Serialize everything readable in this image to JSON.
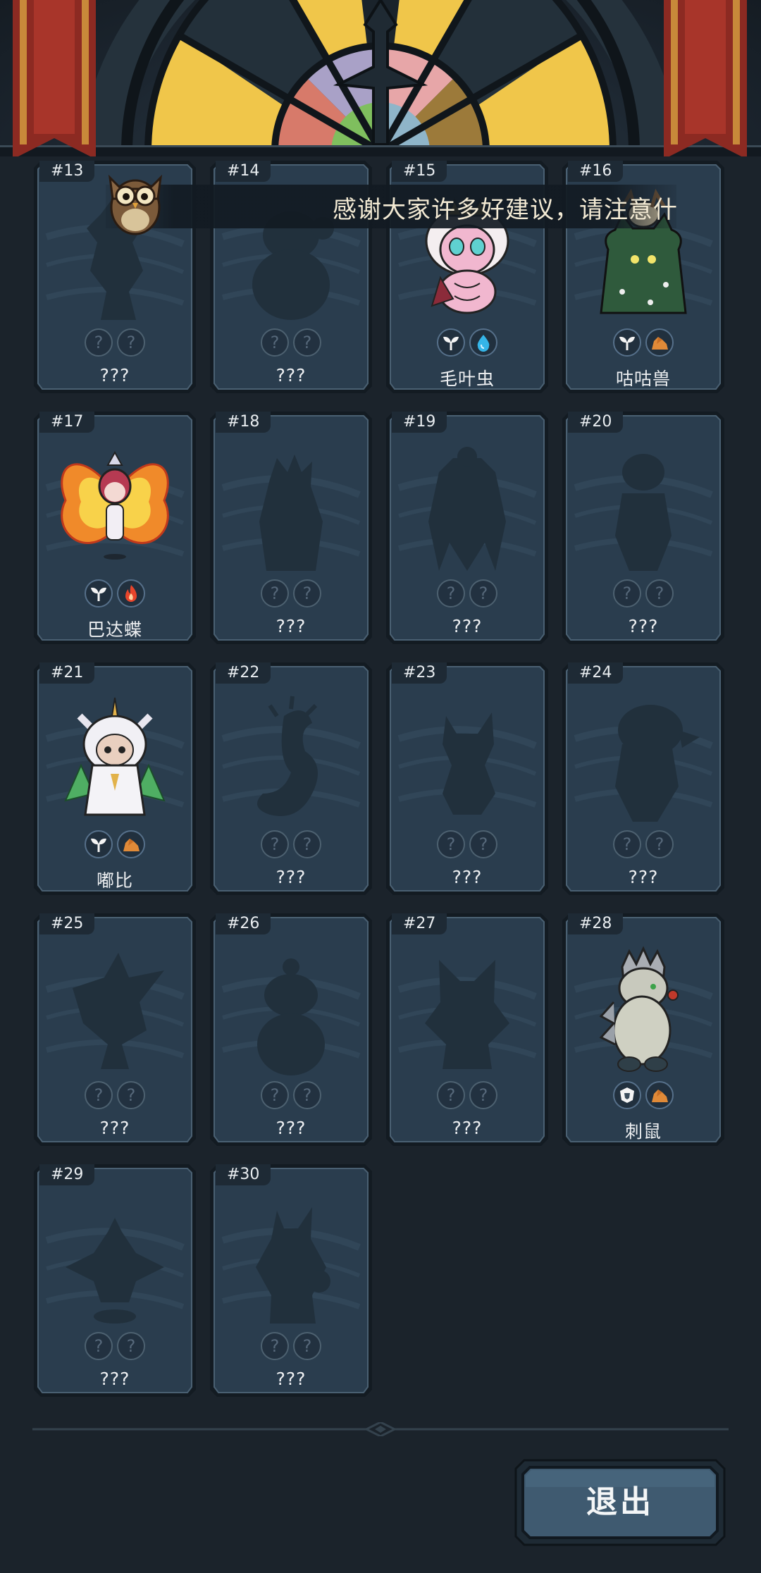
{
  "ticker": {
    "text": "感谢大家许多好建议，请注意什"
  },
  "cards": [
    {
      "id": "#13",
      "name": "???",
      "discovered": false,
      "elements": [
        "?",
        "?"
      ]
    },
    {
      "id": "#14",
      "name": "???",
      "discovered": false,
      "elements": [
        "?",
        "?"
      ]
    },
    {
      "id": "#15",
      "name": "毛叶虫",
      "discovered": true,
      "elements": [
        "leaf-icon",
        "water-icon"
      ]
    },
    {
      "id": "#16",
      "name": "咕咕兽",
      "discovered": true,
      "elements": [
        "leaf-icon",
        "rock-icon"
      ]
    },
    {
      "id": "#17",
      "name": "巴达蝶",
      "discovered": true,
      "elements": [
        "leaf-icon",
        "fire-icon"
      ]
    },
    {
      "id": "#18",
      "name": "???",
      "discovered": false,
      "elements": [
        "?",
        "?"
      ]
    },
    {
      "id": "#19",
      "name": "???",
      "discovered": false,
      "elements": [
        "?",
        "?"
      ]
    },
    {
      "id": "#20",
      "name": "???",
      "discovered": false,
      "elements": [
        "?",
        "?"
      ]
    },
    {
      "id": "#21",
      "name": "嘟比",
      "discovered": true,
      "elements": [
        "leaf-icon",
        "rock-icon"
      ]
    },
    {
      "id": "#22",
      "name": "???",
      "discovered": false,
      "elements": [
        "?",
        "?"
      ]
    },
    {
      "id": "#23",
      "name": "???",
      "discovered": false,
      "elements": [
        "?",
        "?"
      ]
    },
    {
      "id": "#24",
      "name": "???",
      "discovered": false,
      "elements": [
        "?",
        "?"
      ]
    },
    {
      "id": "#25",
      "name": "???",
      "discovered": false,
      "elements": [
        "?",
        "?"
      ]
    },
    {
      "id": "#26",
      "name": "???",
      "discovered": false,
      "elements": [
        "?",
        "?"
      ]
    },
    {
      "id": "#27",
      "name": "???",
      "discovered": false,
      "elements": [
        "?",
        "?"
      ]
    },
    {
      "id": "#28",
      "name": "刺鼠",
      "discovered": true,
      "elements": [
        "armor-icon",
        "rock-icon"
      ]
    },
    {
      "id": "#29",
      "name": "???",
      "discovered": false,
      "elements": [
        "?",
        "?"
      ]
    },
    {
      "id": "#30",
      "name": "???",
      "discovered": false,
      "elements": [
        "?",
        "?"
      ]
    }
  ],
  "exit_button": {
    "label": "退出"
  },
  "colors": {
    "background": "#1b232b",
    "card": "#2a3d4e",
    "card_border": "#111820",
    "silhouette": "#22313e",
    "glass_yellow": "#f2c94c",
    "banner_red": "#9a2a22",
    "exit_fill": "#3f5a70"
  }
}
